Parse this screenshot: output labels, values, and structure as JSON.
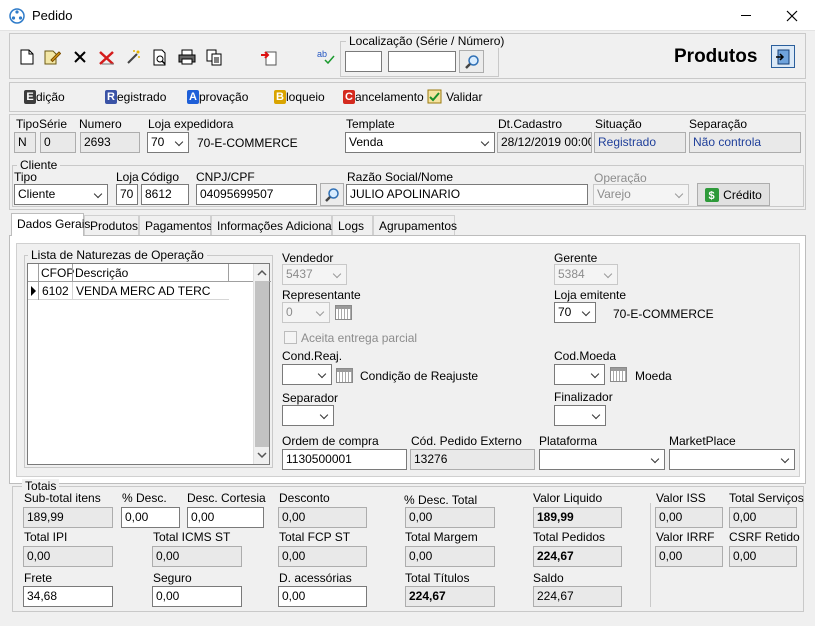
{
  "window": {
    "title": "Pedido"
  },
  "localizacao": {
    "label": "Localização (Série / Número)",
    "serie": "",
    "numero": ""
  },
  "header": {
    "heading": "Produtos"
  },
  "actions": [
    {
      "letter": "E",
      "rest": "dição",
      "color": "#3c3c3c"
    },
    {
      "letter": "R",
      "rest": "egistrado",
      "color": "#3a53a6"
    },
    {
      "letter": "A",
      "rest": "provação",
      "color": "#1e5fd8"
    },
    {
      "letter": "B",
      "rest": "loqueio",
      "color": "#d9a400"
    },
    {
      "letter": "C",
      "rest": "ancelamento",
      "color": "#d42a1e"
    }
  ],
  "validar_label": "Validar",
  "top": {
    "tipo_label": "Tipo",
    "tipo": "N",
    "serie_label": "Série",
    "serie": "0",
    "numero_label": "Numero",
    "numero": "2693",
    "loja_exp_label": "Loja expedidora",
    "loja_exp": "70",
    "loja_exp_name": "70-E-COMMERCE",
    "template_label": "Template",
    "template": "Venda",
    "dtcad_label": "Dt.Cadastro",
    "dtcad": "28/12/2019 00:00",
    "situacao_label": "Situação",
    "situacao": "Registrado",
    "separacao_label": "Separação",
    "separacao": "Não controla"
  },
  "cliente": {
    "group_label": "Cliente",
    "tipo_label": "Tipo",
    "tipo": "Cliente",
    "loja_label": "Loja",
    "loja": "70",
    "codigo_label": "Código",
    "codigo": "8612",
    "cnpj_label": "CNPJ/CPF",
    "cnpj": "04095699507",
    "razao_label": "Razão Social/Nome",
    "razao": "JULIO APOLINARIO",
    "operacao_label": "Operação",
    "operacao": "Varejo",
    "credito_label": "Crédito"
  },
  "tabs": [
    "Dados Gerais",
    "Produtos",
    "Pagamentos",
    "Informações Adicionais",
    "Logs",
    "Agrupamentos"
  ],
  "naturezas": {
    "group_label": "Lista de Naturezas de Operação",
    "col_cfop": "CFOP",
    "col_desc": "Descrição",
    "rows": [
      {
        "cfop": "6102",
        "desc": "VENDA MERC AD TERC"
      }
    ]
  },
  "dados": {
    "vendedor_label": "Vendedor",
    "vendedor": "5437",
    "representante_label": "Representante",
    "representante": "0",
    "aceita_label": "Aceita entrega parcial",
    "condreaj_label": "Cond.Reaj.",
    "condreaj_desc": "Condição de Reajuste",
    "separador_label": "Separador",
    "gerente_label": "Gerente",
    "gerente": "5384",
    "loja_emit_label": "Loja emitente",
    "loja_emit": "70",
    "loja_emit_name": "70-E-COMMERCE",
    "codmoeda_label": "Cod.Moeda",
    "moeda_desc": "Moeda",
    "finalizador_label": "Finalizador",
    "ordem_label": "Ordem de compra",
    "ordem": "1130500001",
    "pedext_label": "Cód. Pedido Externo",
    "pedext": "13276",
    "plataforma_label": "Plataforma",
    "marketplace_label": "MarketPlace"
  },
  "totais": {
    "group_label": "Totais",
    "subtotal_label": "Sub-total itens",
    "subtotal": "189,99",
    "pdesc_label": "% Desc.",
    "pdesc": "0,00",
    "desccort_label": "Desc. Cortesia",
    "desccort": "0,00",
    "desconto_label": "Desconto",
    "desconto": "0,00",
    "pdesctot_label": "% Desc. Total",
    "pdesctot": "0,00",
    "vliq_label": "Valor Liquido",
    "vliq": "189,99",
    "vliss_label": "Valor ISS",
    "vliss": "0,00",
    "totserv_label": "Total Serviços",
    "totserv": "0,00",
    "totipi_label": "Total IPI",
    "totipi": "0,00",
    "toticms_label": "Total ICMS ST",
    "toticms": "0,00",
    "totfcp_label": "Total FCP ST",
    "totfcp": "0,00",
    "totmargem_label": "Total Margem",
    "totmargem": "0,00",
    "totped_label": "Total Pedidos",
    "totped": "224,67",
    "virrf_label": "Valor IRRF",
    "virrf": "0,00",
    "csrf_label": "CSRF Retido",
    "csrf": "0,00",
    "frete_label": "Frete",
    "frete": "34,68",
    "seguro_label": "Seguro",
    "seguro": "0,00",
    "dacess_label": "D. acessórias",
    "dacess": "0,00",
    "tottit_label": "Total Títulos",
    "tottit": "224,67",
    "saldo_label": "Saldo",
    "saldo": "224,67"
  }
}
